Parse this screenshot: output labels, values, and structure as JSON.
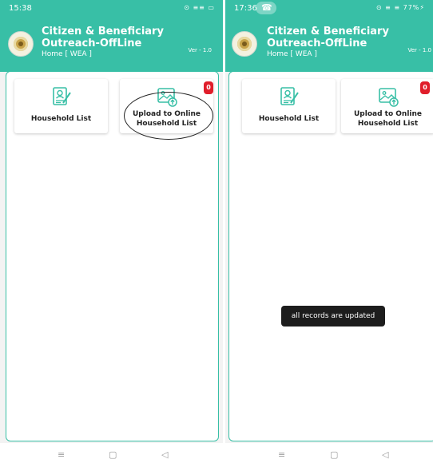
{
  "left": {
    "status": {
      "time": "15:38",
      "icons": "⊙ ≡≡ ▭"
    },
    "app": {
      "title_line1": "Citizen & Beneficiary",
      "title_line2": "Outreach-OffLine",
      "subtitle": "Home [ WEA ]",
      "version": "Ver - 1.0"
    },
    "cards": [
      {
        "label": "Household List"
      },
      {
        "label": "Upload to Online Household List",
        "badge": "0"
      }
    ]
  },
  "right": {
    "status": {
      "time": "17:36",
      "call_icon": "☎",
      "icons": "⊙ ≡ ≡ 77%⚡"
    },
    "app": {
      "title_line1": "Citizen & Beneficiary",
      "title_line2": "Outreach-OffLine",
      "subtitle": "Home [ WEA ]",
      "version": "Ver - 1.0"
    },
    "cards": [
      {
        "label": "Household List"
      },
      {
        "label": "Upload to Online Household List",
        "badge": "0"
      }
    ],
    "toast": "all records are updated"
  },
  "navbar": {
    "menu": "≡",
    "home": "▢",
    "back": "◁"
  },
  "colors": {
    "header": "#38bfa6",
    "badge": "#e01e2b",
    "toast": "#1d1d1d"
  },
  "icons": [
    "person-document-icon",
    "image-upload-icon",
    "call-icon",
    "logo-seal-icon"
  ]
}
